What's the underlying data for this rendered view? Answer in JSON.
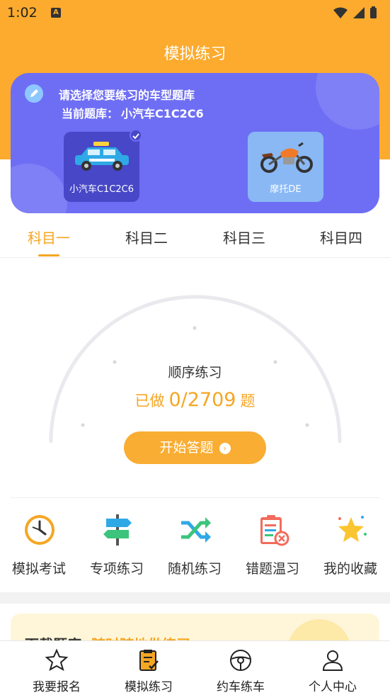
{
  "status_bar": {
    "time": "1:02",
    "app_icon_letter": "A"
  },
  "header": {
    "title": "模拟练习"
  },
  "card": {
    "prompt": "请选择您要练习的车型题库",
    "current_label": "当前题库：",
    "current_value": "小汽车C1C2C6",
    "vehicles": [
      {
        "label": "小汽车C1C2C6",
        "icon": "car-icon",
        "selected": true
      },
      {
        "label": "摩托DE",
        "icon": "motorcycle-icon",
        "selected": false
      }
    ]
  },
  "tabs": [
    {
      "label": "科目一",
      "active": true
    },
    {
      "label": "科目二",
      "active": false
    },
    {
      "label": "科目三",
      "active": false
    },
    {
      "label": "科目四",
      "active": false
    }
  ],
  "practice": {
    "title": "顺序练习",
    "count_prefix": "已做",
    "count_value": "0/2709",
    "count_suffix": "题",
    "start_label": "开始答题"
  },
  "features": [
    {
      "label": "模拟考试",
      "icon": "clock-icon"
    },
    {
      "label": "专项练习",
      "icon": "signpost-icon"
    },
    {
      "label": "随机练习",
      "icon": "shuffle-icon"
    },
    {
      "label": "错题温习",
      "icon": "clipboard-error-icon"
    },
    {
      "label": "我的收藏",
      "icon": "star-icon"
    }
  ],
  "banner": {
    "title": "下载题库",
    "subtitle": "随时随地做练习"
  },
  "bottom_nav": [
    {
      "label": "我要报名",
      "icon": "star-outline-icon"
    },
    {
      "label": "模拟练习",
      "icon": "notebook-icon"
    },
    {
      "label": "约车练车",
      "icon": "steering-wheel-icon"
    },
    {
      "label": "个人中心",
      "icon": "person-icon"
    }
  ],
  "colors": {
    "accent": "#fcab2e",
    "card": "#6e6ef5",
    "text": "#333333"
  }
}
